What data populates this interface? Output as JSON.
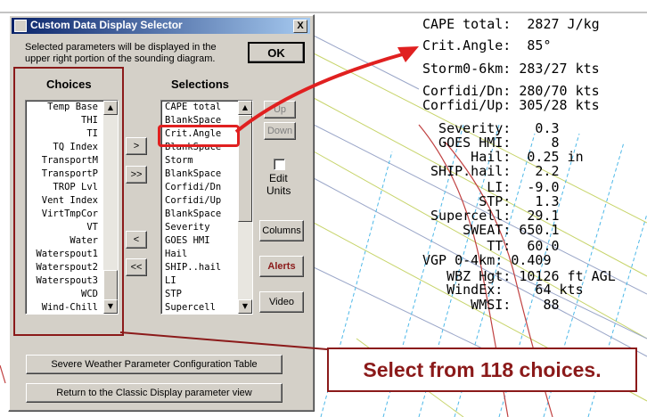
{
  "dialog": {
    "title": "Custom Data Display Selector",
    "close_label": "X",
    "info_line1": "Selected parameters will be displayed in the",
    "info_line2": "upper right portion of the sounding diagram.",
    "ok_label": "OK",
    "choices_header": "Choices",
    "selections_header": "Selections",
    "choices": [
      "Temp Base",
      "THI",
      "TI",
      "TQ Index",
      "TransportM",
      "TransportP",
      "TROP Lvl",
      "Vent Index",
      "VirtTmpCor",
      "VT",
      "Water",
      "Waterspout1",
      "Waterspout2",
      "Waterspout3",
      "WCD",
      "Wind-Chill"
    ],
    "selections": [
      "CAPE total",
      "BlankSpace",
      "Crit.Angle",
      "BlankSpace",
      "Storm",
      "BlankSpace",
      "Corfidi/Dn",
      "Corfidi/Up",
      "BlankSpace",
      "Severity",
      "GOES HMI",
      "Hail",
      "SHIP..hail",
      "LI",
      "STP",
      "Supercell"
    ],
    "add_label": ">",
    "add_all_label": ">>",
    "remove_label": "<",
    "remove_all_label": "<<",
    "up_label": "Up",
    "down_label": "Down",
    "edit_units_line1": "Edit",
    "edit_units_line2": "Units",
    "columns_label": "Columns",
    "alerts_label": "Alerts",
    "video_label": "Video",
    "config_table_label": "Severe Weather Parameter Configuration Table",
    "classic_view_label": "Return to the Classic Display parameter view"
  },
  "readout": [
    "CAPE total:  2827 J/kg",
    "Crit.Angle:  85°",
    "Storm0-6km: 283/27 kts",
    "Corfidi/Dn: 280/70 kts",
    "Corfidi/Up: 305/28 kts",
    "  Severity:   0.3",
    "  GOES HMI:     8",
    "      Hail:  0.25 in",
    " SHIP.hail:   2.2",
    "        LI:  -9.0",
    "       STP:   1.3",
    " Supercell:  29.1",
    "     SWEAT: 650.1",
    "        TT:  60.0",
    "VGP 0-4km: 0.409",
    "   WBZ Hgt: 10126 ft AGL",
    "   WindEx:    64 kts",
    "      WMSI:    88"
  ],
  "callout": "Select from 118 choices.",
  "colors": {
    "accent": "#8b1a1a",
    "arrow": "#e02020",
    "title_start": "#0a246a",
    "title_end": "#a6caf0"
  }
}
